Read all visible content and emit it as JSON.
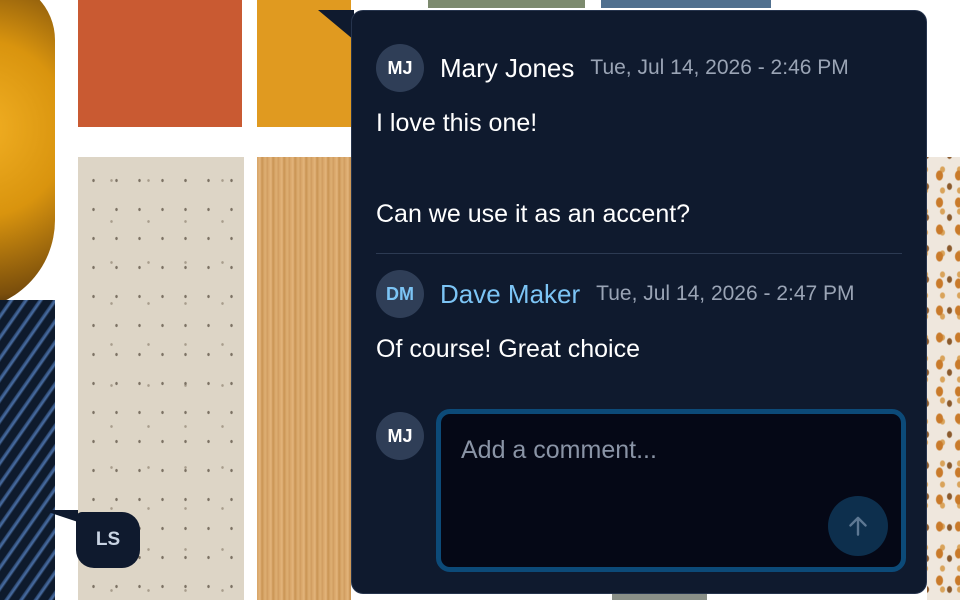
{
  "marker": {
    "initials": "LS"
  },
  "thread": {
    "comments": [
      {
        "initials": "MJ",
        "author": "Mary Jones",
        "timestamp": "Tue, Jul 14, 2026 - 2:46 PM",
        "lines": [
          "I love this one!",
          "Can we use it as an accent?"
        ]
      },
      {
        "initials": "DM",
        "author": "Dave Maker",
        "timestamp": "Tue, Jul 14, 2026 - 2:47 PM",
        "lines": [
          "Of course! Great choice"
        ]
      }
    ]
  },
  "composer": {
    "initials": "MJ",
    "placeholder": "Add a comment...",
    "send_icon": "arrow-up-icon"
  },
  "colors": {
    "panel_bg": "#0f1a2e",
    "accent": "#7cc4f5",
    "composer_border": "#0c4a78"
  }
}
